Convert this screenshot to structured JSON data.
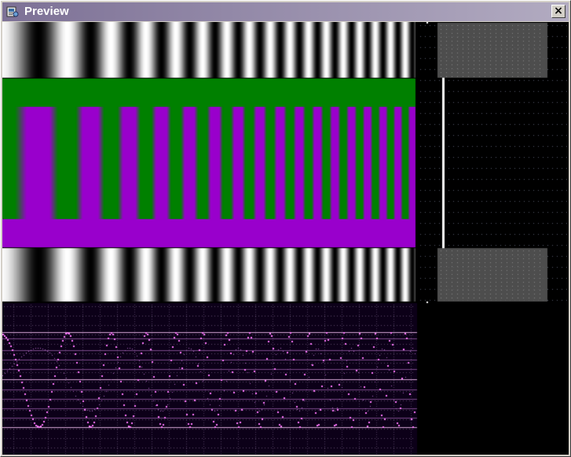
{
  "window": {
    "title": "Preview",
    "close_symbol": "×",
    "icon": "preview-app-icon"
  },
  "colors": {
    "titlebar_start": "#7d7196",
    "titlebar_end": "#b2abc1",
    "band_green": "#008000",
    "band_magenta": "#9900cc",
    "scope_grid": "#d9a8d9",
    "scope_trace": "#ff77ff",
    "scope_background": "#0c0018",
    "selection_box": "#5a5a5a",
    "selection_line": "#ffffff"
  },
  "preview": {
    "pattern": "chirp",
    "bands": [
      "grayscale-chirp",
      "green-band",
      "green-magenta-chirp",
      "magenta-band",
      "grayscale-chirp"
    ],
    "scope": "waveform-view"
  }
}
